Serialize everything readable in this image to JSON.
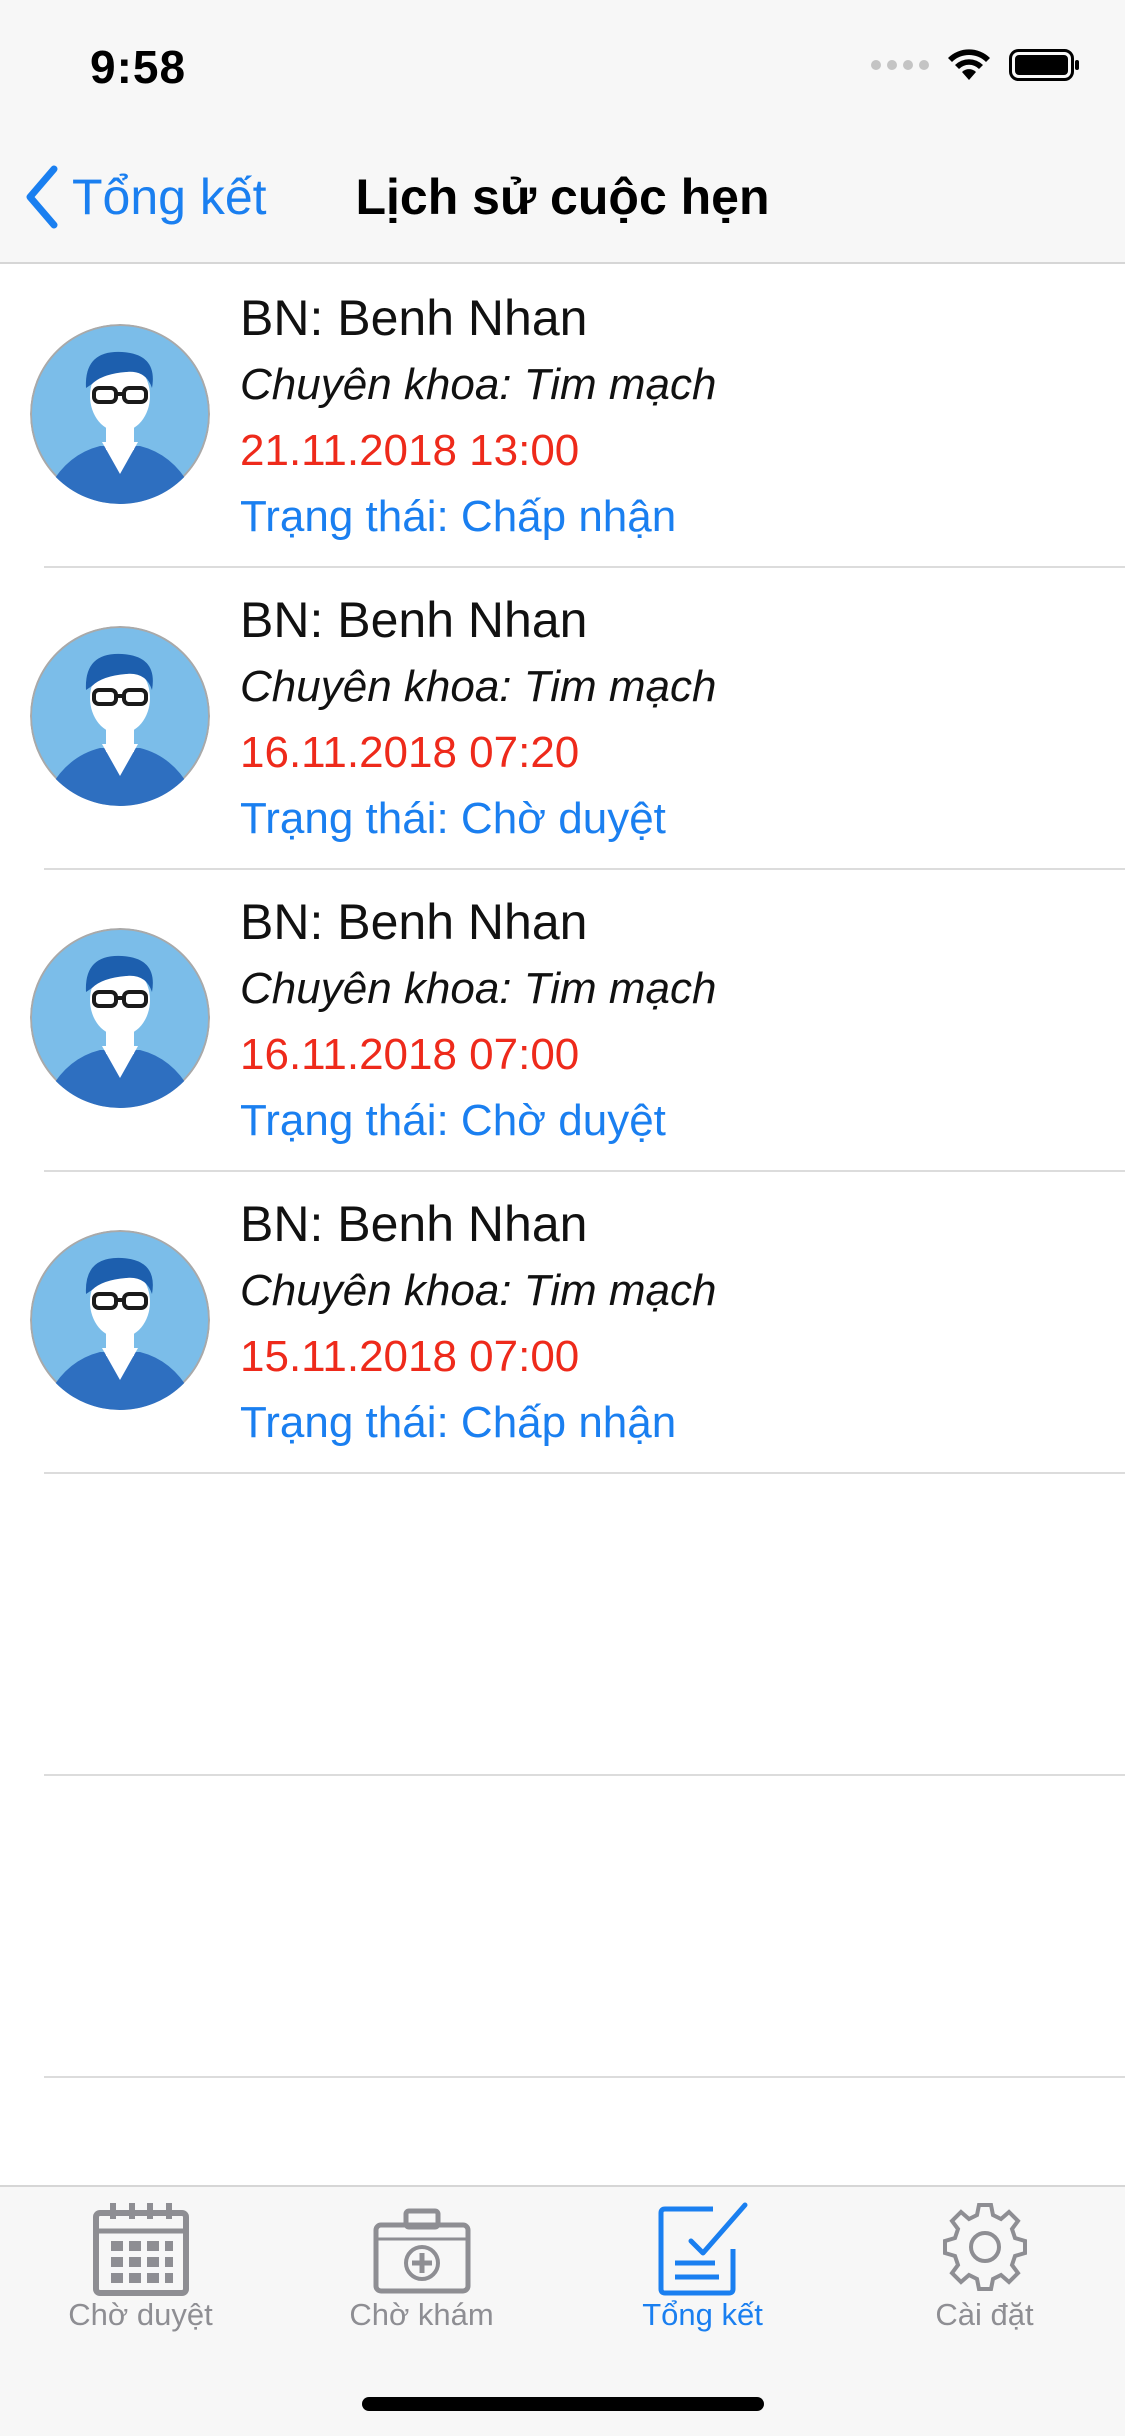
{
  "status_bar": {
    "time": "9:58"
  },
  "nav": {
    "back_label": "Tổng kết",
    "title": "Lịch sử cuộc hẹn"
  },
  "appointments": [
    {
      "patient": "BN: Benh Nhan",
      "specialty": "Chuyên khoa: Tim mạch",
      "datetime": "21.11.2018 13:00",
      "status": "Trạng thái: Chấp nhận"
    },
    {
      "patient": "BN: Benh Nhan",
      "specialty": "Chuyên khoa: Tim mạch",
      "datetime": "16.11.2018 07:20",
      "status": "Trạng thái: Chờ duyệt"
    },
    {
      "patient": "BN: Benh Nhan",
      "specialty": "Chuyên khoa: Tim mạch",
      "datetime": "16.11.2018 07:00",
      "status": "Trạng thái: Chờ duyệt"
    },
    {
      "patient": "BN: Benh Nhan",
      "specialty": "Chuyên khoa: Tim mạch",
      "datetime": "15.11.2018 07:00",
      "status": "Trạng thái: Chấp nhận"
    }
  ],
  "tabs": [
    {
      "label": "Chờ duyệt",
      "icon": "calendar-icon"
    },
    {
      "label": "Chờ khám",
      "icon": "medical-kit-icon"
    },
    {
      "label": "Tổng kết",
      "icon": "checklist-icon",
      "active": true
    },
    {
      "label": "Cài đặt",
      "icon": "gear-icon"
    }
  ],
  "colors": {
    "accent": "#1a7ff0",
    "date": "#ee2a1b",
    "inactive": "#8e8e93",
    "avatar_bg": "#7bbde9"
  }
}
